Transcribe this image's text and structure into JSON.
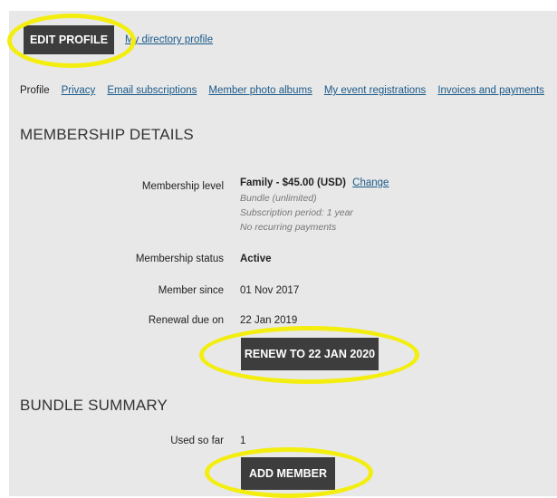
{
  "header": {
    "edit_profile_label": "EDIT PROFILE",
    "directory_link": "My directory profile"
  },
  "tabs": [
    {
      "label": "Profile",
      "active": true
    },
    {
      "label": "Privacy",
      "active": false
    },
    {
      "label": "Email subscriptions",
      "active": false
    },
    {
      "label": "Member photo albums",
      "active": false
    },
    {
      "label": "My event registrations",
      "active": false
    },
    {
      "label": "Invoices and payments",
      "active": false
    }
  ],
  "membership": {
    "title": "MEMBERSHIP DETAILS",
    "level_label": "Membership level",
    "level_value": "Family - $45.00 (USD)",
    "change_link": "Change",
    "bundle_note": "Bundle (unlimited)",
    "period_note": "Subscription period: 1 year",
    "recurring_note": "No recurring payments",
    "status_label": "Membership status",
    "status_value": "Active",
    "since_label": "Member since",
    "since_value": "01 Nov 2017",
    "renewal_label": "Renewal due on",
    "renewal_value": "22 Jan 2019",
    "renew_button": "RENEW TO 22 JAN 2020"
  },
  "bundle": {
    "title": "BUNDLE SUMMARY",
    "used_label": "Used so far",
    "used_value": "1",
    "add_button": "ADD MEMBER"
  },
  "colors": {
    "panel_bg": "#e8e8e8",
    "button_bg": "#3d3d3d",
    "link": "#1a5a8a",
    "highlight": "#f3ee0f"
  }
}
